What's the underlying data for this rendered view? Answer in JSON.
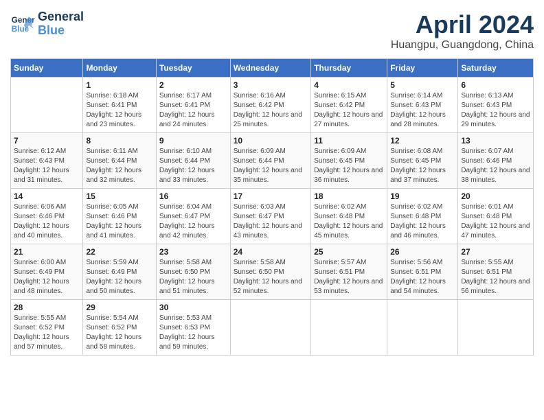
{
  "header": {
    "logo_line1": "General",
    "logo_line2": "Blue",
    "month": "April 2024",
    "location": "Huangpu, Guangdong, China"
  },
  "days_of_week": [
    "Sunday",
    "Monday",
    "Tuesday",
    "Wednesday",
    "Thursday",
    "Friday",
    "Saturday"
  ],
  "weeks": [
    [
      {
        "day": "",
        "sunrise": "",
        "sunset": "",
        "daylight": ""
      },
      {
        "day": "1",
        "sunrise": "Sunrise: 6:18 AM",
        "sunset": "Sunset: 6:41 PM",
        "daylight": "Daylight: 12 hours and 23 minutes."
      },
      {
        "day": "2",
        "sunrise": "Sunrise: 6:17 AM",
        "sunset": "Sunset: 6:41 PM",
        "daylight": "Daylight: 12 hours and 24 minutes."
      },
      {
        "day": "3",
        "sunrise": "Sunrise: 6:16 AM",
        "sunset": "Sunset: 6:42 PM",
        "daylight": "Daylight: 12 hours and 25 minutes."
      },
      {
        "day": "4",
        "sunrise": "Sunrise: 6:15 AM",
        "sunset": "Sunset: 6:42 PM",
        "daylight": "Daylight: 12 hours and 27 minutes."
      },
      {
        "day": "5",
        "sunrise": "Sunrise: 6:14 AM",
        "sunset": "Sunset: 6:43 PM",
        "daylight": "Daylight: 12 hours and 28 minutes."
      },
      {
        "day": "6",
        "sunrise": "Sunrise: 6:13 AM",
        "sunset": "Sunset: 6:43 PM",
        "daylight": "Daylight: 12 hours and 29 minutes."
      }
    ],
    [
      {
        "day": "7",
        "sunrise": "Sunrise: 6:12 AM",
        "sunset": "Sunset: 6:43 PM",
        "daylight": "Daylight: 12 hours and 31 minutes."
      },
      {
        "day": "8",
        "sunrise": "Sunrise: 6:11 AM",
        "sunset": "Sunset: 6:44 PM",
        "daylight": "Daylight: 12 hours and 32 minutes."
      },
      {
        "day": "9",
        "sunrise": "Sunrise: 6:10 AM",
        "sunset": "Sunset: 6:44 PM",
        "daylight": "Daylight: 12 hours and 33 minutes."
      },
      {
        "day": "10",
        "sunrise": "Sunrise: 6:09 AM",
        "sunset": "Sunset: 6:44 PM",
        "daylight": "Daylight: 12 hours and 35 minutes."
      },
      {
        "day": "11",
        "sunrise": "Sunrise: 6:09 AM",
        "sunset": "Sunset: 6:45 PM",
        "daylight": "Daylight: 12 hours and 36 minutes."
      },
      {
        "day": "12",
        "sunrise": "Sunrise: 6:08 AM",
        "sunset": "Sunset: 6:45 PM",
        "daylight": "Daylight: 12 hours and 37 minutes."
      },
      {
        "day": "13",
        "sunrise": "Sunrise: 6:07 AM",
        "sunset": "Sunset: 6:46 PM",
        "daylight": "Daylight: 12 hours and 38 minutes."
      }
    ],
    [
      {
        "day": "14",
        "sunrise": "Sunrise: 6:06 AM",
        "sunset": "Sunset: 6:46 PM",
        "daylight": "Daylight: 12 hours and 40 minutes."
      },
      {
        "day": "15",
        "sunrise": "Sunrise: 6:05 AM",
        "sunset": "Sunset: 6:46 PM",
        "daylight": "Daylight: 12 hours and 41 minutes."
      },
      {
        "day": "16",
        "sunrise": "Sunrise: 6:04 AM",
        "sunset": "Sunset: 6:47 PM",
        "daylight": "Daylight: 12 hours and 42 minutes."
      },
      {
        "day": "17",
        "sunrise": "Sunrise: 6:03 AM",
        "sunset": "Sunset: 6:47 PM",
        "daylight": "Daylight: 12 hours and 43 minutes."
      },
      {
        "day": "18",
        "sunrise": "Sunrise: 6:02 AM",
        "sunset": "Sunset: 6:48 PM",
        "daylight": "Daylight: 12 hours and 45 minutes."
      },
      {
        "day": "19",
        "sunrise": "Sunrise: 6:02 AM",
        "sunset": "Sunset: 6:48 PM",
        "daylight": "Daylight: 12 hours and 46 minutes."
      },
      {
        "day": "20",
        "sunrise": "Sunrise: 6:01 AM",
        "sunset": "Sunset: 6:48 PM",
        "daylight": "Daylight: 12 hours and 47 minutes."
      }
    ],
    [
      {
        "day": "21",
        "sunrise": "Sunrise: 6:00 AM",
        "sunset": "Sunset: 6:49 PM",
        "daylight": "Daylight: 12 hours and 48 minutes."
      },
      {
        "day": "22",
        "sunrise": "Sunrise: 5:59 AM",
        "sunset": "Sunset: 6:49 PM",
        "daylight": "Daylight: 12 hours and 50 minutes."
      },
      {
        "day": "23",
        "sunrise": "Sunrise: 5:58 AM",
        "sunset": "Sunset: 6:50 PM",
        "daylight": "Daylight: 12 hours and 51 minutes."
      },
      {
        "day": "24",
        "sunrise": "Sunrise: 5:58 AM",
        "sunset": "Sunset: 6:50 PM",
        "daylight": "Daylight: 12 hours and 52 minutes."
      },
      {
        "day": "25",
        "sunrise": "Sunrise: 5:57 AM",
        "sunset": "Sunset: 6:51 PM",
        "daylight": "Daylight: 12 hours and 53 minutes."
      },
      {
        "day": "26",
        "sunrise": "Sunrise: 5:56 AM",
        "sunset": "Sunset: 6:51 PM",
        "daylight": "Daylight: 12 hours and 54 minutes."
      },
      {
        "day": "27",
        "sunrise": "Sunrise: 5:55 AM",
        "sunset": "Sunset: 6:51 PM",
        "daylight": "Daylight: 12 hours and 56 minutes."
      }
    ],
    [
      {
        "day": "28",
        "sunrise": "Sunrise: 5:55 AM",
        "sunset": "Sunset: 6:52 PM",
        "daylight": "Daylight: 12 hours and 57 minutes."
      },
      {
        "day": "29",
        "sunrise": "Sunrise: 5:54 AM",
        "sunset": "Sunset: 6:52 PM",
        "daylight": "Daylight: 12 hours and 58 minutes."
      },
      {
        "day": "30",
        "sunrise": "Sunrise: 5:53 AM",
        "sunset": "Sunset: 6:53 PM",
        "daylight": "Daylight: 12 hours and 59 minutes."
      },
      {
        "day": "",
        "sunrise": "",
        "sunset": "",
        "daylight": ""
      },
      {
        "day": "",
        "sunrise": "",
        "sunset": "",
        "daylight": ""
      },
      {
        "day": "",
        "sunrise": "",
        "sunset": "",
        "daylight": ""
      },
      {
        "day": "",
        "sunrise": "",
        "sunset": "",
        "daylight": ""
      }
    ]
  ]
}
